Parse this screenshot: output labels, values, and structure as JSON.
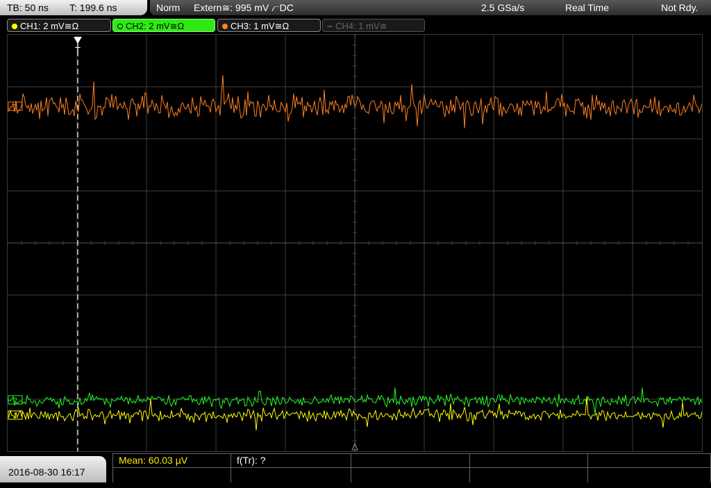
{
  "status": {
    "timebase": "TB: 50 ns",
    "trigger_time": "T: 199.6 ns",
    "trigger_mode": "Norm",
    "trigger_source": "Extern≅: 995 mV ⦧DC",
    "sample_rate": "2.5 GSa/s",
    "acquisition": "Real Time",
    "state": "Not Rdy."
  },
  "channels": [
    {
      "label": "CH1: 2 mV≅Ω",
      "color": "#ffff00"
    },
    {
      "label": "CH2: 2 mV≅Ω",
      "color": "#22ff22"
    },
    {
      "label": "CH3: 1 mV≅Ω",
      "color": "#ff8020"
    },
    {
      "label": "CH4: 1 mV≅",
      "color": "#777777"
    }
  ],
  "markers": {
    "trigger_marker": "T",
    "ch3_marker": "3",
    "ch2_marker": "2",
    "ch1_marker": "1"
  },
  "bottom": {
    "datetime": "2016-08-30 16:17",
    "mean": "Mean: 60.03 µV",
    "f_tr": "f(Tr): ?"
  },
  "colors": {
    "grid": "#555555",
    "ch1": "#ffff00",
    "ch2": "#22ff22",
    "ch3": "#ff8020"
  }
}
